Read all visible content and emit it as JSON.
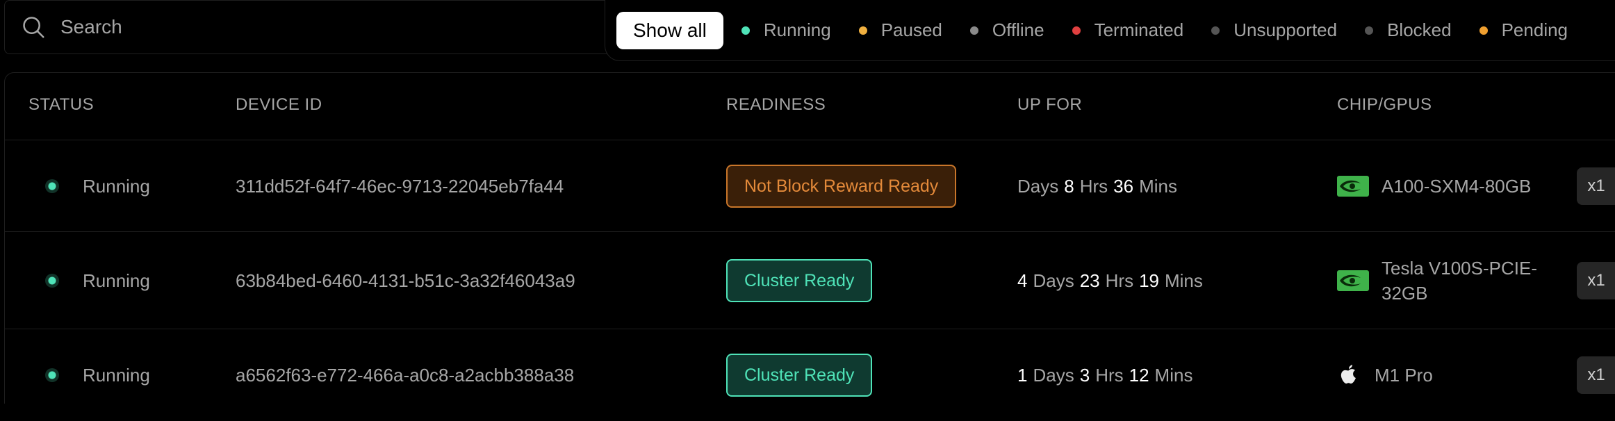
{
  "search": {
    "placeholder": "Search"
  },
  "filters": {
    "show_all": "Show all",
    "items": [
      {
        "label": "Running",
        "color": "#4fe3b8"
      },
      {
        "label": "Paused",
        "color": "#f0b040"
      },
      {
        "label": "Offline",
        "color": "#8a8a8a"
      },
      {
        "label": "Terminated",
        "color": "#e04040"
      },
      {
        "label": "Unsupported",
        "color": "#555555"
      },
      {
        "label": "Blocked",
        "color": "#555555"
      },
      {
        "label": "Pending",
        "color": "#f0a030"
      }
    ]
  },
  "table": {
    "headers": {
      "status": "STATUS",
      "device_id": "DEVICE ID",
      "readiness": "READINESS",
      "up_for": "UP FOR",
      "chip": "CHIP/GPUS"
    },
    "rows": [
      {
        "status": "Running",
        "device_id": "311dd52f-64f7-46ec-9713-22045eb7fa44",
        "readiness": "Not Block Reward Ready",
        "readiness_type": "warn",
        "uptime": {
          "days_label": "Days",
          "hrs_val": "8",
          "hrs_label": "Hrs",
          "mins_val": "36",
          "mins_label": "Mins"
        },
        "chip_line1": "A100-SXM4-80GB",
        "chip_icon": "nvidia-icon",
        "count": "x1"
      },
      {
        "status": "Running",
        "device_id": "63b84bed-6460-4131-b51c-3a32f46043a9",
        "readiness": "Cluster Ready",
        "readiness_type": "ok",
        "uptime": {
          "days_val": "4",
          "days_label": "Days",
          "hrs_val": "23",
          "hrs_label": "Hrs",
          "mins_val": "19",
          "mins_label": "Mins"
        },
        "chip_line1": "Tesla V100S-PCIE-",
        "chip_line2": "32GB",
        "chip_icon": "nvidia-icon",
        "count": "x1"
      },
      {
        "status": "Running",
        "device_id": "a6562f63-e772-466a-a0c8-a2acbb388a38",
        "readiness": "Cluster Ready",
        "readiness_type": "ok",
        "uptime": {
          "days_val": "1",
          "days_label": "Days",
          "hrs_val": "3",
          "hrs_label": "Hrs",
          "mins_val": "12",
          "mins_label": "Mins"
        },
        "chip_line1": "M1 Pro",
        "chip_icon": "apple-icon",
        "count": "x1"
      }
    ]
  }
}
